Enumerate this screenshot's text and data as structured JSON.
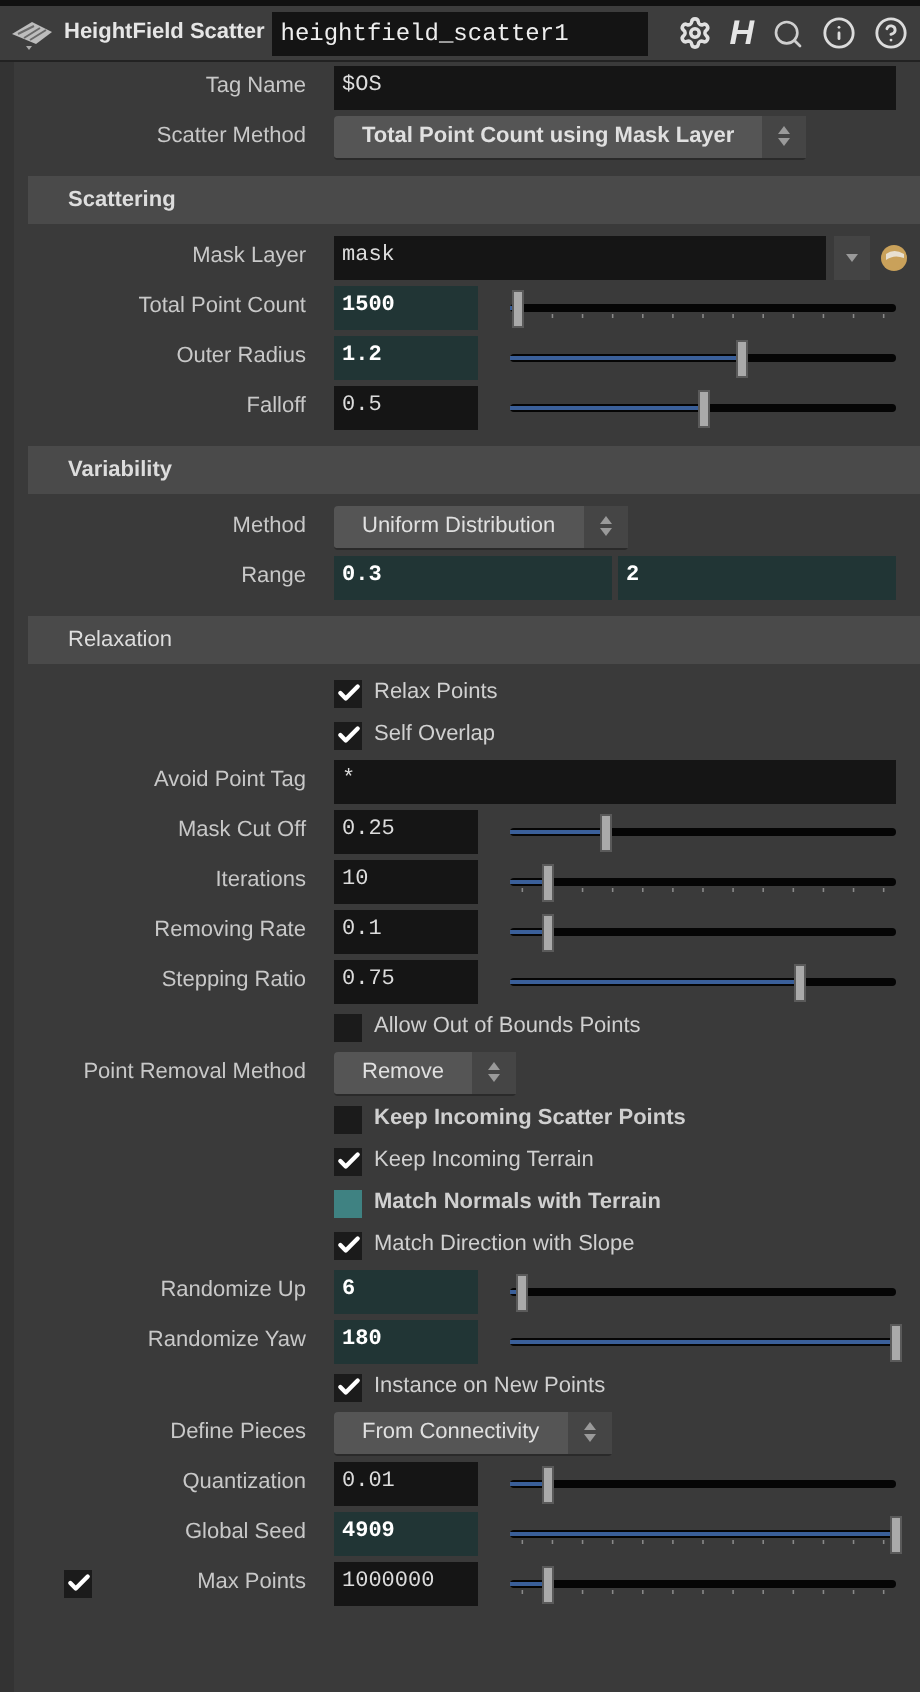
{
  "header": {
    "node_type": "HeightField Scatter",
    "node_name": "heightfield_scatter1",
    "glyph": "H"
  },
  "rows": [
    {
      "kind": "text",
      "label": "Tag Name",
      "value": "$OS"
    },
    {
      "kind": "menu",
      "label": "Scatter Method",
      "value": "Total Point Count using Mask Layer",
      "modified": true
    },
    {
      "kind": "section",
      "title": "Scattering",
      "modified": true
    },
    {
      "kind": "string_menu",
      "label": "Mask Layer",
      "value": "mask"
    },
    {
      "kind": "slider",
      "label": "Total Point Count",
      "value": "1500",
      "level": 0.02,
      "modified": true,
      "ticks": true
    },
    {
      "kind": "slider",
      "label": "Outer Radius",
      "value": "1.2",
      "level": 0.6,
      "modified": true,
      "ticks": false
    },
    {
      "kind": "slider",
      "label": "Falloff",
      "value": "0.5",
      "level": 0.5,
      "modified": false,
      "ticks": false
    },
    {
      "kind": "section",
      "title": "Variability",
      "modified": true
    },
    {
      "kind": "menu",
      "label": "Method",
      "value": "Uniform Distribution",
      "modified": false
    },
    {
      "kind": "pair",
      "label": "Range",
      "values": [
        "0.3",
        "2"
      ],
      "modified": true
    },
    {
      "kind": "section",
      "title": "Relaxation",
      "modified": false
    },
    {
      "kind": "toggle",
      "label": "Relax Points",
      "checked": true,
      "modified": false,
      "highlighted": false
    },
    {
      "kind": "toggle",
      "label": "Self Overlap",
      "checked": true,
      "modified": false,
      "highlighted": false
    },
    {
      "kind": "text",
      "label": "Avoid Point Tag",
      "value": "*"
    },
    {
      "kind": "slider",
      "label": "Mask Cut Off",
      "value": "0.25",
      "level": 0.25,
      "modified": false,
      "ticks": false
    },
    {
      "kind": "slider",
      "label": "Iterations",
      "value": "10",
      "level": 0.1,
      "modified": false,
      "ticks": true
    },
    {
      "kind": "slider",
      "label": "Removing Rate",
      "value": "0.1",
      "level": 0.1,
      "modified": false,
      "ticks": false
    },
    {
      "kind": "slider",
      "label": "Stepping Ratio",
      "value": "0.75",
      "level": 0.75,
      "modified": false,
      "ticks": false
    },
    {
      "kind": "toggle",
      "label": "Allow Out of Bounds Points",
      "checked": false,
      "modified": false,
      "highlighted": false
    },
    {
      "kind": "menu",
      "label": "Point Removal Method",
      "value": "Remove",
      "modified": false
    },
    {
      "kind": "toggle",
      "label": "Keep Incoming Scatter Points",
      "checked": false,
      "modified": true,
      "highlighted": false
    },
    {
      "kind": "toggle",
      "label": "Keep Incoming Terrain",
      "checked": true,
      "modified": false,
      "highlighted": false
    },
    {
      "kind": "toggle",
      "label": "Match Normals with Terrain",
      "checked": false,
      "modified": true,
      "highlighted": true
    },
    {
      "kind": "toggle",
      "label": "Match Direction with Slope",
      "checked": true,
      "modified": false,
      "highlighted": false
    },
    {
      "kind": "slider",
      "label": "Randomize Up",
      "value": "6",
      "level": 0.03,
      "modified": true,
      "ticks": false
    },
    {
      "kind": "slider",
      "label": "Randomize Yaw",
      "value": "180",
      "level": 1,
      "modified": true,
      "ticks": false
    },
    {
      "kind": "toggle",
      "label": "Instance on New Points",
      "checked": true,
      "modified": false,
      "highlighted": false
    },
    {
      "kind": "menu",
      "label": "Define Pieces",
      "value": "From Connectivity",
      "modified": false
    },
    {
      "kind": "slider",
      "label": "Quantization",
      "value": "0.01",
      "level": 0.1,
      "modified": false,
      "ticks": false
    },
    {
      "kind": "slider",
      "label": "Global Seed",
      "value": "4909",
      "level": 1,
      "modified": true,
      "ticks": true
    },
    {
      "kind": "slider",
      "label": "Max Points",
      "value": "1000000",
      "level": 0.1,
      "modified": false,
      "ticks": true,
      "enable": {
        "checked": true
      }
    }
  ]
}
